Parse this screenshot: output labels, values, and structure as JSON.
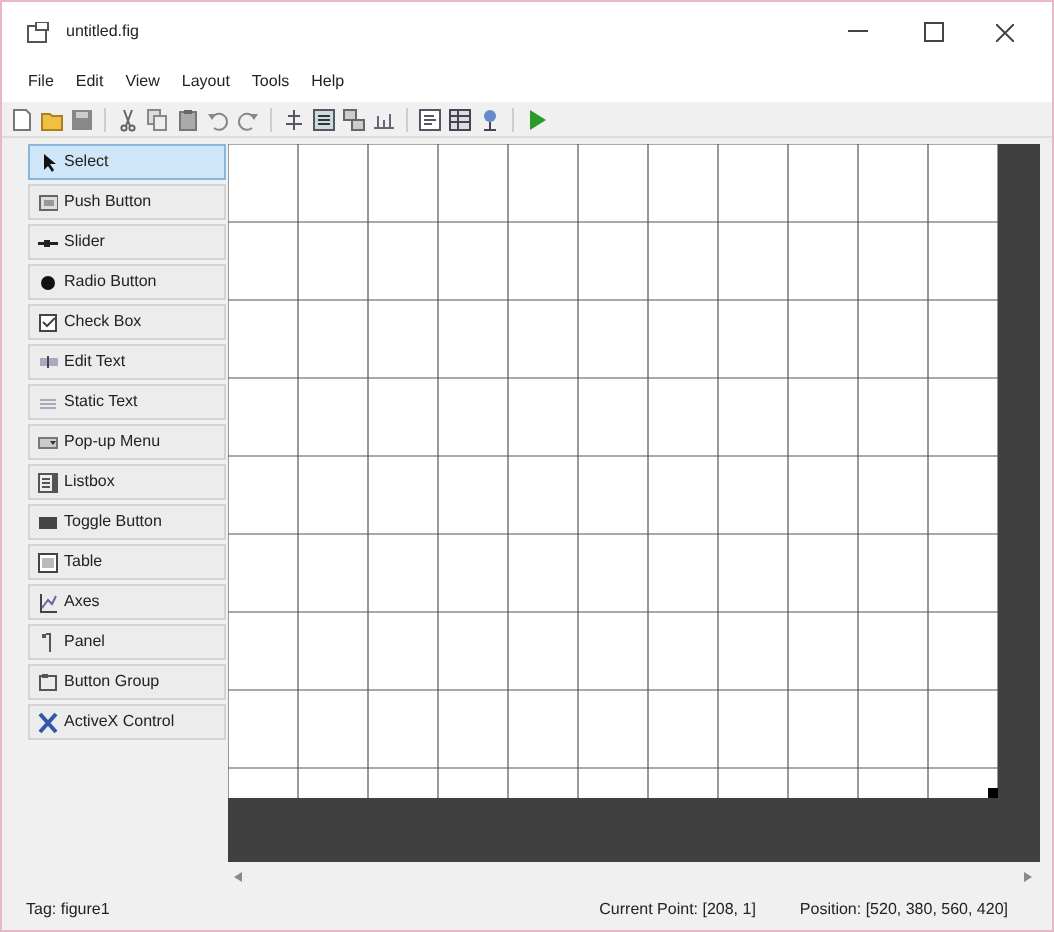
{
  "window": {
    "title": "untitled.fig"
  },
  "menu": [
    "File",
    "Edit",
    "View",
    "Layout",
    "Tools",
    "Help"
  ],
  "toolbar": [
    {
      "kind": "new"
    },
    {
      "kind": "open"
    },
    {
      "kind": "save"
    },
    {
      "kind": "sep"
    },
    {
      "kind": "cut"
    },
    {
      "kind": "copy"
    },
    {
      "kind": "paste"
    },
    {
      "kind": "undo"
    },
    {
      "kind": "redo"
    },
    {
      "kind": "sep"
    },
    {
      "kind": "align"
    },
    {
      "kind": "menu"
    },
    {
      "kind": "tab"
    },
    {
      "kind": "toolbar"
    },
    {
      "kind": "sep"
    },
    {
      "kind": "editor"
    },
    {
      "kind": "inspector"
    },
    {
      "kind": "browser"
    },
    {
      "kind": "sep"
    },
    {
      "kind": "run"
    }
  ],
  "palette": [
    {
      "kind": "select",
      "label": "Select",
      "selected": true
    },
    {
      "kind": "push",
      "label": "Push Button",
      "selected": false
    },
    {
      "kind": "slider",
      "label": "Slider",
      "selected": false
    },
    {
      "kind": "radio",
      "label": "Radio Button",
      "selected": false
    },
    {
      "kind": "check",
      "label": "Check Box",
      "selected": false
    },
    {
      "kind": "edit",
      "label": "Edit Text",
      "selected": false
    },
    {
      "kind": "static",
      "label": "Static Text",
      "selected": false
    },
    {
      "kind": "popup",
      "label": "Pop-up Menu",
      "selected": false
    },
    {
      "kind": "listbox",
      "label": "Listbox",
      "selected": false
    },
    {
      "kind": "toggle",
      "label": "Toggle Button",
      "selected": false
    },
    {
      "kind": "table",
      "label": "Table",
      "selected": false
    },
    {
      "kind": "axes",
      "label": "Axes",
      "selected": false
    },
    {
      "kind": "panel",
      "label": "Panel",
      "selected": false
    },
    {
      "kind": "group",
      "label": "Button Group",
      "selected": false
    },
    {
      "kind": "activex",
      "label": "ActiveX Control",
      "selected": false
    }
  ],
  "status_bar": {
    "tag": "Tag: figure1",
    "current_point": "Current Point: [208, 1]",
    "position": "Position: [520, 380, 560, 420]"
  }
}
